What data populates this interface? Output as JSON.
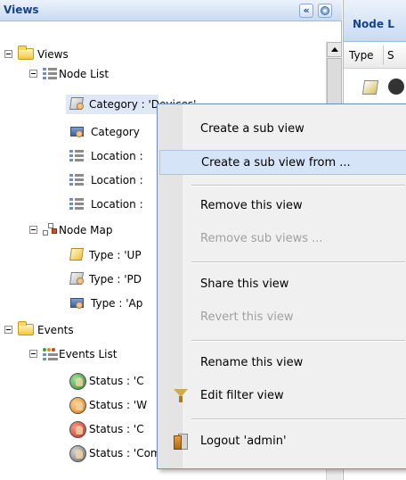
{
  "views_panel": {
    "title": "Views",
    "tree": [
      {
        "id": "views-root",
        "label": "Views"
      },
      {
        "id": "node-list",
        "label": "Node List"
      },
      {
        "id": "category-devices",
        "label": "Category : 'Devices'"
      },
      {
        "id": "category-2",
        "label": "Category"
      },
      {
        "id": "location-1",
        "label": "Location :"
      },
      {
        "id": "location-2",
        "label": "Location :"
      },
      {
        "id": "location-3",
        "label": "Location :"
      },
      {
        "id": "node-map",
        "label": "Node Map"
      },
      {
        "id": "type-up",
        "label": "Type : 'UP"
      },
      {
        "id": "type-pd",
        "label": "Type : 'PD"
      },
      {
        "id": "type-ap",
        "label": "Type : 'Ap"
      },
      {
        "id": "events",
        "label": "Events"
      },
      {
        "id": "events-list",
        "label": "Events List"
      },
      {
        "id": "status-1",
        "label": "Status : 'C"
      },
      {
        "id": "status-2",
        "label": "Status : 'W"
      },
      {
        "id": "status-3",
        "label": "Status : 'C"
      },
      {
        "id": "status-4",
        "label": "Status : 'Communication Lost'"
      }
    ]
  },
  "node_panel": {
    "title": "Node L",
    "columns": [
      "Type",
      "S"
    ]
  },
  "context_menu": {
    "items": [
      {
        "label": "Create a sub view",
        "disabled": false
      },
      {
        "label": "Create a sub view from ...",
        "disabled": false
      },
      {
        "label": "Remove this view",
        "disabled": false
      },
      {
        "label": "Remove sub views ...",
        "disabled": true
      },
      {
        "label": "Share this view",
        "disabled": false
      },
      {
        "label": "Revert this view",
        "disabled": true
      },
      {
        "label": "Rename this view",
        "disabled": false
      },
      {
        "label": "Edit filter view",
        "disabled": false,
        "icon": "funnel-icon"
      },
      {
        "label": "Logout 'admin'",
        "disabled": false,
        "icon": "door-icon"
      }
    ],
    "active_item": "Create a sub view from ...",
    "colors": {
      "active_bg": "#d6e4f8",
      "disabled_text": "#a0a0a0"
    }
  },
  "colors": {
    "header_text": "#15428b",
    "border": "#99bbe8",
    "selected_row": "#dfe8f6"
  }
}
